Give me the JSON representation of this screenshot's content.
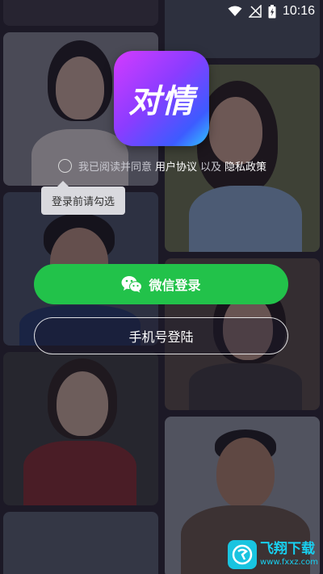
{
  "status_bar": {
    "time": "10:16",
    "icons": [
      "wifi-icon",
      "no-signal-icon",
      "battery-icon"
    ]
  },
  "logo": {
    "text": "对情"
  },
  "agreement": {
    "prefix": "我已阅读并同意",
    "user_agreement": "用户协议",
    "and": "以及",
    "privacy_policy": "隐私政策"
  },
  "tooltip": {
    "text": "登录前请勾选"
  },
  "buttons": {
    "wechat_login": "微信登录",
    "phone_login": "手机号登陆"
  },
  "watermark": {
    "cn": "飞翔下载",
    "en": "www.fxxz.com"
  },
  "colors": {
    "wechat_green": "#22c24a",
    "logo_gradient": [
      "#d43bff",
      "#8b3cff",
      "#3d5bff",
      "#32c4ff"
    ]
  }
}
